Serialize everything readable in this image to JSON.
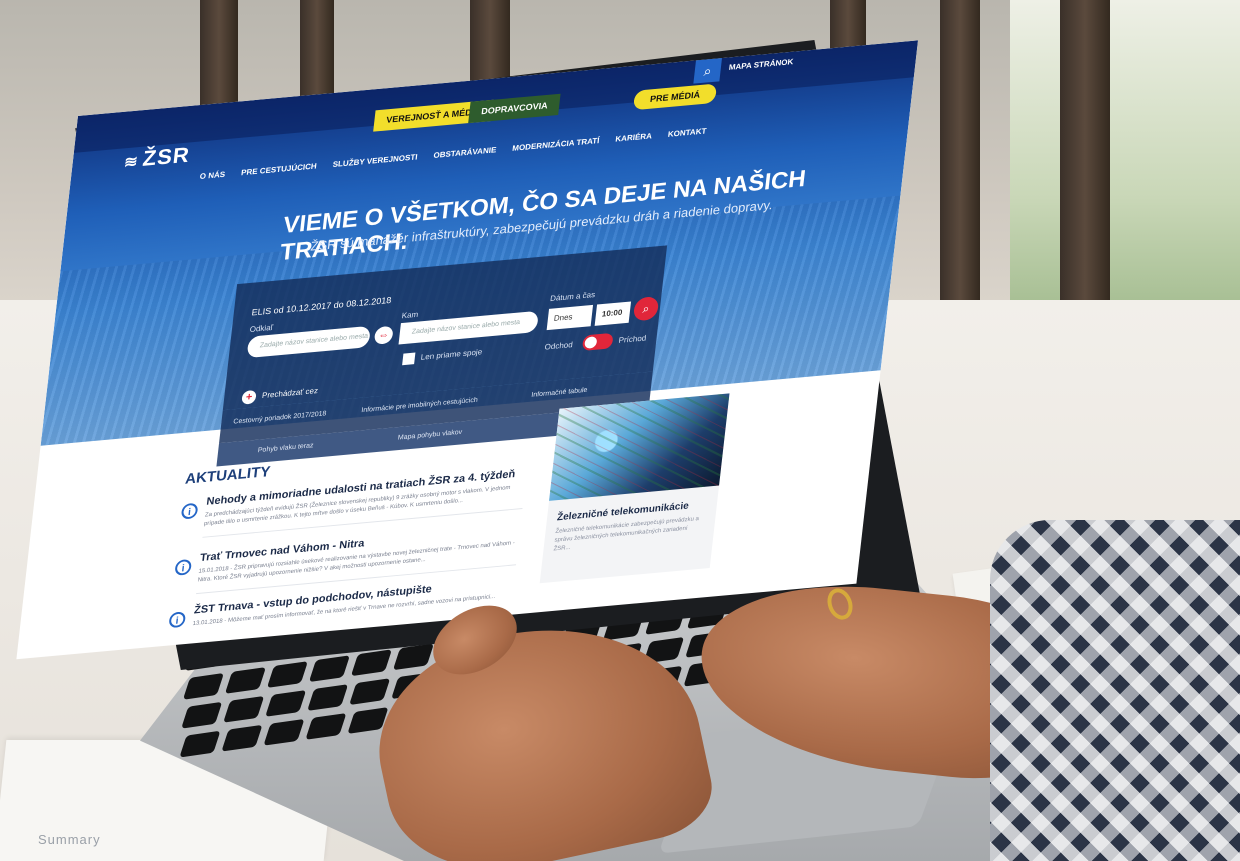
{
  "site": {
    "logo": "ŽSR",
    "tabs": [
      "VEREJNOSŤ A MÉDIÁ",
      "DOPRAVCOVIA"
    ],
    "search_icon": "search-icon",
    "sitemap": "MAPA STRÁNOK",
    "media_button": "PRE MÉDIÁ",
    "nav": [
      "O NÁS",
      "PRE CESTUJÚCICH",
      "SLUŽBY VEREJNOSTI",
      "OBSTARÁVANIE",
      "MODERNIZÁCIA TRATÍ",
      "KARIÉRA",
      "KONTAKT"
    ]
  },
  "hero": {
    "title": "VIEME O VŠETKOM, ČO SA DEJE NA NAŠICH TRATIACH.",
    "subtitle": "ŽSR sú manažér infraštruktúry, zabezpečujú prevádzku dráh a riadenie dopravy."
  },
  "search": {
    "validity": "ELIS od 10.12.2017 do 08.12.2018",
    "from_label": "Odkiaľ",
    "to_label": "Kam",
    "date_label": "Dátum a čas",
    "from_placeholder": "Zadajte názov stanice alebo mesta",
    "to_placeholder": "Zadajte názov stanice alebo mesta",
    "date_value": "Dnes",
    "time_value": "10:00",
    "direct_label": "Len priame spoje",
    "departure_label": "Odchod",
    "arrival_label": "Príchod",
    "via_label": "Prechádzať cez"
  },
  "links": [
    "Cestovný poriadok 2017/2018",
    "Informácie pre imobilných cestujúcich",
    "Informačné tabule",
    "Pohyb vlaku teraz",
    "Mapa pohybu vlakov"
  ],
  "news": {
    "heading": "AKTUALITY",
    "items": [
      {
        "title": "Nehody a mimoriadne udalosti na tratiach ŽSR za 4. týždeň",
        "body": "Za predchádzajúci týždeň evidujú ŽSR (Železnice slovenskej republiky) 9 zrážky osobný motor s vlakom. V jednom prípade išlo o usmrtenie zrážkou. K tejto mŕtve došlo v úseku Beňuš - Kúbov. K usmrteniu došlo..."
      },
      {
        "title": "Trať Trnovec nad Váhom - Nitra",
        "body": "15.01.2018 - ŽSR pripravujú rozsiahle úsekové realizovanie na výstavbe novej železničnej trate - Trnovec nad Váhom - Nitra. Ktoré ŽSR vyjadrujú upozornenie nižšie? V akej možnosti upozornenie ostane..."
      },
      {
        "title": "ŽST Trnava - vstup do podchodov, nástupište",
        "body": "13.01.2018 - Môžeme mať prosím informovať, že na ktoré riešiť v Trnave ne rozvrhí, sadne vozovi na prístupnici..."
      }
    ]
  },
  "side_card": {
    "title": "Železničné telekomunikácie",
    "body": "Železničné telekomunikácie zabezpečujú prevádzku a správu železničných telekomunikačných zariadení ŽSR..."
  },
  "scene": {
    "paper_text": "Summary"
  }
}
